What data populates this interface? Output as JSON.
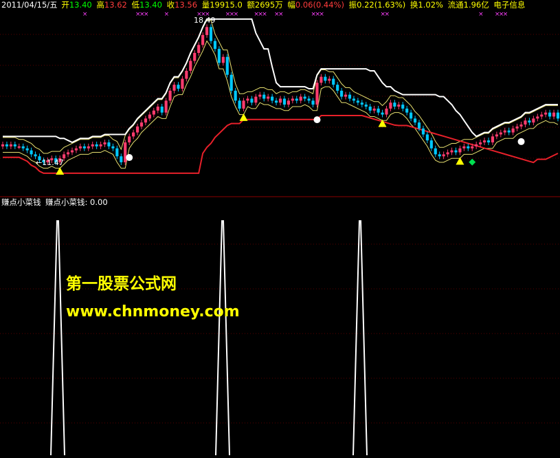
{
  "header": {
    "date": "2011/04/15/五",
    "open_label": "开",
    "open": "13.40",
    "high_label": "高",
    "high": "13.62",
    "low_label": "低",
    "low": "13.40",
    "close_label": "收",
    "close": "13.56",
    "volume_label": "量",
    "volume": "19915.0",
    "amount_label": "额",
    "amount": "2695万",
    "change_label": "幅",
    "change": "0.06(0.44%)",
    "amplitude_label": "振",
    "amplitude": "0.22(1.63%)",
    "turnover_label": "换",
    "turnover": "1.02%",
    "float_label": "流通",
    "float": "1.96亿",
    "sector": "电子信息"
  },
  "colors": {
    "up": "#ff3c6e",
    "down": "#00c8ff",
    "red_line": "#e8202a",
    "white_line": "#ffffff",
    "envelope": "#e8e070",
    "yellow_text": "#ffff00",
    "green_text": "#00ff00",
    "divider": "#8b0000"
  },
  "price_panel": {
    "peak_label": "18.49",
    "low_marker_label": "←11.47",
    "markers": [
      {
        "type": "yellow-triangle",
        "bar": 14
      },
      {
        "type": "white-dot",
        "bar": 31
      },
      {
        "type": "yellow-triangle",
        "bar": 59
      },
      {
        "type": "white-dot",
        "bar": 77
      },
      {
        "type": "yellow-triangle",
        "bar": 93
      },
      {
        "type": "yellow-triangle",
        "bar": 112
      },
      {
        "type": "green-diamond",
        "bar": 115
      },
      {
        "type": "white-dot",
        "bar": 127
      }
    ],
    "x_marks": [
      20,
      33,
      34,
      35,
      40,
      48,
      49,
      50,
      55,
      56,
      57,
      62,
      63,
      64,
      67,
      68,
      76,
      77,
      78,
      93,
      94,
      117,
      121,
      122,
      123
    ]
  },
  "indicator_panel": {
    "title": "赚点小菜钱",
    "value_label": "赚点小菜钱: 0.00"
  },
  "watermark": {
    "line1": "第一股票公式网",
    "line2": "www.chnmoney.com"
  },
  "chart_data": {
    "type": "candlestick",
    "title": "",
    "peak_price": 18.49,
    "low_price": 11.47,
    "indicator": {
      "name": "赚点小菜钱",
      "current_value": 0.0,
      "spikes": [
        {
          "bar": 14,
          "value": 1
        },
        {
          "bar": 58,
          "value": 1
        },
        {
          "bar": 95,
          "value": 1
        }
      ],
      "ylim": [
        0,
        1.1
      ]
    },
    "bars": [
      [
        12.3,
        12.4
      ],
      [
        12.4,
        12.3
      ],
      [
        12.3,
        12.4
      ],
      [
        12.4,
        12.3
      ],
      [
        12.3,
        12.3
      ],
      [
        12.3,
        12.2
      ],
      [
        12.2,
        12.1
      ],
      [
        12.1,
        11.9
      ],
      [
        11.9,
        11.8
      ],
      [
        11.8,
        11.6
      ],
      [
        11.6,
        11.5
      ],
      [
        11.5,
        11.6
      ],
      [
        11.6,
        11.7
      ],
      [
        11.7,
        11.5
      ],
      [
        11.5,
        11.7
      ],
      [
        11.7,
        11.9
      ],
      [
        11.9,
        12.0
      ],
      [
        12.0,
        12.1
      ],
      [
        12.1,
        12.2
      ],
      [
        12.2,
        12.3
      ],
      [
        12.3,
        12.2
      ],
      [
        12.2,
        12.3
      ],
      [
        12.3,
        12.4
      ],
      [
        12.4,
        12.3
      ],
      [
        12.3,
        12.4
      ],
      [
        12.4,
        12.5
      ],
      [
        12.5,
        12.3
      ],
      [
        12.3,
        12.2
      ],
      [
        12.2,
        11.8
      ],
      [
        11.8,
        11.5
      ],
      [
        11.5,
        12.5
      ],
      [
        12.5,
        12.8
      ],
      [
        12.8,
        13.0
      ],
      [
        13.0,
        13.3
      ],
      [
        13.3,
        13.5
      ],
      [
        13.5,
        13.7
      ],
      [
        13.7,
        13.9
      ],
      [
        13.9,
        14.1
      ],
      [
        14.1,
        14.3
      ],
      [
        14.3,
        14.0
      ],
      [
        14.0,
        14.6
      ],
      [
        14.6,
        15.1
      ],
      [
        15.1,
        15.4
      ],
      [
        15.4,
        15.2
      ],
      [
        15.2,
        15.7
      ],
      [
        15.7,
        16.1
      ],
      [
        16.1,
        16.6
      ],
      [
        16.6,
        17.0
      ],
      [
        17.0,
        17.4
      ],
      [
        17.4,
        17.9
      ],
      [
        17.9,
        18.3
      ],
      [
        18.3,
        17.6
      ],
      [
        17.6,
        17.2
      ],
      [
        17.2,
        16.5
      ],
      [
        16.5,
        16.8
      ],
      [
        16.8,
        15.9
      ],
      [
        15.9,
        15.1
      ],
      [
        15.1,
        14.6
      ],
      [
        14.6,
        14.2
      ],
      [
        14.2,
        14.6
      ],
      [
        14.6,
        14.7
      ],
      [
        14.7,
        14.5
      ],
      [
        14.5,
        14.8
      ],
      [
        14.8,
        14.9
      ],
      [
        14.9,
        14.7
      ],
      [
        14.7,
        14.8
      ],
      [
        14.8,
        14.6
      ],
      [
        14.6,
        14.5
      ],
      [
        14.5,
        14.7
      ],
      [
        14.7,
        14.4
      ],
      [
        14.4,
        14.6
      ],
      [
        14.6,
        14.7
      ],
      [
        14.7,
        14.6
      ],
      [
        14.6,
        14.8
      ],
      [
        14.8,
        14.7
      ],
      [
        14.7,
        14.6
      ],
      [
        14.6,
        14.4
      ],
      [
        14.4,
        15.5
      ],
      [
        15.5,
        15.8
      ],
      [
        15.8,
        15.6
      ],
      [
        15.6,
        15.7
      ],
      [
        15.7,
        15.4
      ],
      [
        15.4,
        15.1
      ],
      [
        15.1,
        14.8
      ],
      [
        14.8,
        14.9
      ],
      [
        14.9,
        14.7
      ],
      [
        14.7,
        14.6
      ],
      [
        14.6,
        14.5
      ],
      [
        14.5,
        14.4
      ],
      [
        14.4,
        14.3
      ],
      [
        14.3,
        14.1
      ],
      [
        14.1,
        14.2
      ],
      [
        14.2,
        14.0
      ],
      [
        14.0,
        13.9
      ],
      [
        13.9,
        14.2
      ],
      [
        14.2,
        14.5
      ],
      [
        14.5,
        14.3
      ],
      [
        14.3,
        14.4
      ],
      [
        14.4,
        14.2
      ],
      [
        14.2,
        14.0
      ],
      [
        14.0,
        13.7
      ],
      [
        13.7,
        13.5
      ],
      [
        13.5,
        13.2
      ],
      [
        13.2,
        12.9
      ],
      [
        12.9,
        12.6
      ],
      [
        12.6,
        12.2
      ],
      [
        12.2,
        11.9
      ],
      [
        11.9,
        11.8
      ],
      [
        11.8,
        11.9
      ],
      [
        11.9,
        12.0
      ],
      [
        12.0,
        12.1
      ],
      [
        12.1,
        12.0
      ],
      [
        12.0,
        12.2
      ],
      [
        12.2,
        12.3
      ],
      [
        12.3,
        12.2
      ],
      [
        12.2,
        12.3
      ],
      [
        12.3,
        12.4
      ],
      [
        12.4,
        12.5
      ],
      [
        12.5,
        12.6
      ],
      [
        12.6,
        12.5
      ],
      [
        12.5,
        12.8
      ],
      [
        12.8,
        12.9
      ],
      [
        12.9,
        13.0
      ],
      [
        13.0,
        13.1
      ],
      [
        13.1,
        13.0
      ],
      [
        13.0,
        13.2
      ],
      [
        13.2,
        13.3
      ],
      [
        13.3,
        13.4
      ],
      [
        13.4,
        13.6
      ],
      [
        13.6,
        13.5
      ],
      [
        13.5,
        13.7
      ],
      [
        13.7,
        13.8
      ],
      [
        13.8,
        13.9
      ],
      [
        13.9,
        14.0
      ],
      [
        14.0,
        13.8
      ],
      [
        13.8,
        14.0
      ],
      [
        14.0,
        13.7
      ]
    ]
  }
}
